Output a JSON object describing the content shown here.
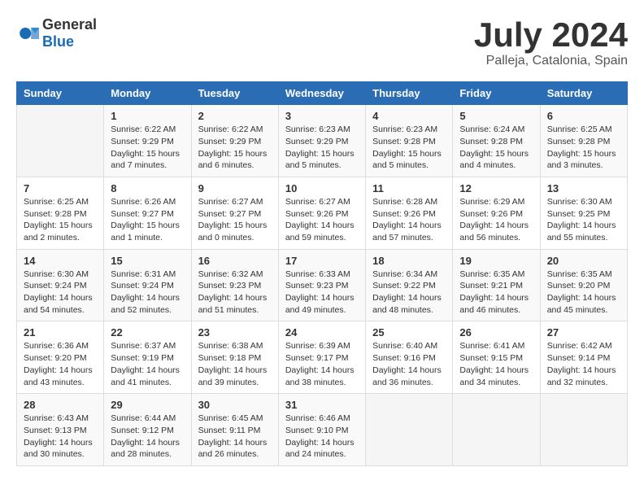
{
  "header": {
    "logo_general": "General",
    "logo_blue": "Blue",
    "month_year": "July 2024",
    "location": "Palleja, Catalonia, Spain"
  },
  "weekdays": [
    "Sunday",
    "Monday",
    "Tuesday",
    "Wednesday",
    "Thursday",
    "Friday",
    "Saturday"
  ],
  "weeks": [
    [
      {
        "date": "",
        "sunrise": "",
        "sunset": "",
        "daylight": ""
      },
      {
        "date": "1",
        "sunrise": "6:22 AM",
        "sunset": "9:29 PM",
        "daylight": "15 hours and 7 minutes."
      },
      {
        "date": "2",
        "sunrise": "6:22 AM",
        "sunset": "9:29 PM",
        "daylight": "15 hours and 6 minutes."
      },
      {
        "date": "3",
        "sunrise": "6:23 AM",
        "sunset": "9:29 PM",
        "daylight": "15 hours and 5 minutes."
      },
      {
        "date": "4",
        "sunrise": "6:23 AM",
        "sunset": "9:28 PM",
        "daylight": "15 hours and 5 minutes."
      },
      {
        "date": "5",
        "sunrise": "6:24 AM",
        "sunset": "9:28 PM",
        "daylight": "15 hours and 4 minutes."
      },
      {
        "date": "6",
        "sunrise": "6:25 AM",
        "sunset": "9:28 PM",
        "daylight": "15 hours and 3 minutes."
      }
    ],
    [
      {
        "date": "7",
        "sunrise": "6:25 AM",
        "sunset": "9:28 PM",
        "daylight": "15 hours and 2 minutes."
      },
      {
        "date": "8",
        "sunrise": "6:26 AM",
        "sunset": "9:27 PM",
        "daylight": "15 hours and 1 minute."
      },
      {
        "date": "9",
        "sunrise": "6:27 AM",
        "sunset": "9:27 PM",
        "daylight": "15 hours and 0 minutes."
      },
      {
        "date": "10",
        "sunrise": "6:27 AM",
        "sunset": "9:26 PM",
        "daylight": "14 hours and 59 minutes."
      },
      {
        "date": "11",
        "sunrise": "6:28 AM",
        "sunset": "9:26 PM",
        "daylight": "14 hours and 57 minutes."
      },
      {
        "date": "12",
        "sunrise": "6:29 AM",
        "sunset": "9:26 PM",
        "daylight": "14 hours and 56 minutes."
      },
      {
        "date": "13",
        "sunrise": "6:30 AM",
        "sunset": "9:25 PM",
        "daylight": "14 hours and 55 minutes."
      }
    ],
    [
      {
        "date": "14",
        "sunrise": "6:30 AM",
        "sunset": "9:24 PM",
        "daylight": "14 hours and 54 minutes."
      },
      {
        "date": "15",
        "sunrise": "6:31 AM",
        "sunset": "9:24 PM",
        "daylight": "14 hours and 52 minutes."
      },
      {
        "date": "16",
        "sunrise": "6:32 AM",
        "sunset": "9:23 PM",
        "daylight": "14 hours and 51 minutes."
      },
      {
        "date": "17",
        "sunrise": "6:33 AM",
        "sunset": "9:23 PM",
        "daylight": "14 hours and 49 minutes."
      },
      {
        "date": "18",
        "sunrise": "6:34 AM",
        "sunset": "9:22 PM",
        "daylight": "14 hours and 48 minutes."
      },
      {
        "date": "19",
        "sunrise": "6:35 AM",
        "sunset": "9:21 PM",
        "daylight": "14 hours and 46 minutes."
      },
      {
        "date": "20",
        "sunrise": "6:35 AM",
        "sunset": "9:20 PM",
        "daylight": "14 hours and 45 minutes."
      }
    ],
    [
      {
        "date": "21",
        "sunrise": "6:36 AM",
        "sunset": "9:20 PM",
        "daylight": "14 hours and 43 minutes."
      },
      {
        "date": "22",
        "sunrise": "6:37 AM",
        "sunset": "9:19 PM",
        "daylight": "14 hours and 41 minutes."
      },
      {
        "date": "23",
        "sunrise": "6:38 AM",
        "sunset": "9:18 PM",
        "daylight": "14 hours and 39 minutes."
      },
      {
        "date": "24",
        "sunrise": "6:39 AM",
        "sunset": "9:17 PM",
        "daylight": "14 hours and 38 minutes."
      },
      {
        "date": "25",
        "sunrise": "6:40 AM",
        "sunset": "9:16 PM",
        "daylight": "14 hours and 36 minutes."
      },
      {
        "date": "26",
        "sunrise": "6:41 AM",
        "sunset": "9:15 PM",
        "daylight": "14 hours and 34 minutes."
      },
      {
        "date": "27",
        "sunrise": "6:42 AM",
        "sunset": "9:14 PM",
        "daylight": "14 hours and 32 minutes."
      }
    ],
    [
      {
        "date": "28",
        "sunrise": "6:43 AM",
        "sunset": "9:13 PM",
        "daylight": "14 hours and 30 minutes."
      },
      {
        "date": "29",
        "sunrise": "6:44 AM",
        "sunset": "9:12 PM",
        "daylight": "14 hours and 28 minutes."
      },
      {
        "date": "30",
        "sunrise": "6:45 AM",
        "sunset": "9:11 PM",
        "daylight": "14 hours and 26 minutes."
      },
      {
        "date": "31",
        "sunrise": "6:46 AM",
        "sunset": "9:10 PM",
        "daylight": "14 hours and 24 minutes."
      },
      {
        "date": "",
        "sunrise": "",
        "sunset": "",
        "daylight": ""
      },
      {
        "date": "",
        "sunrise": "",
        "sunset": "",
        "daylight": ""
      },
      {
        "date": "",
        "sunrise": "",
        "sunset": "",
        "daylight": ""
      }
    ]
  ]
}
